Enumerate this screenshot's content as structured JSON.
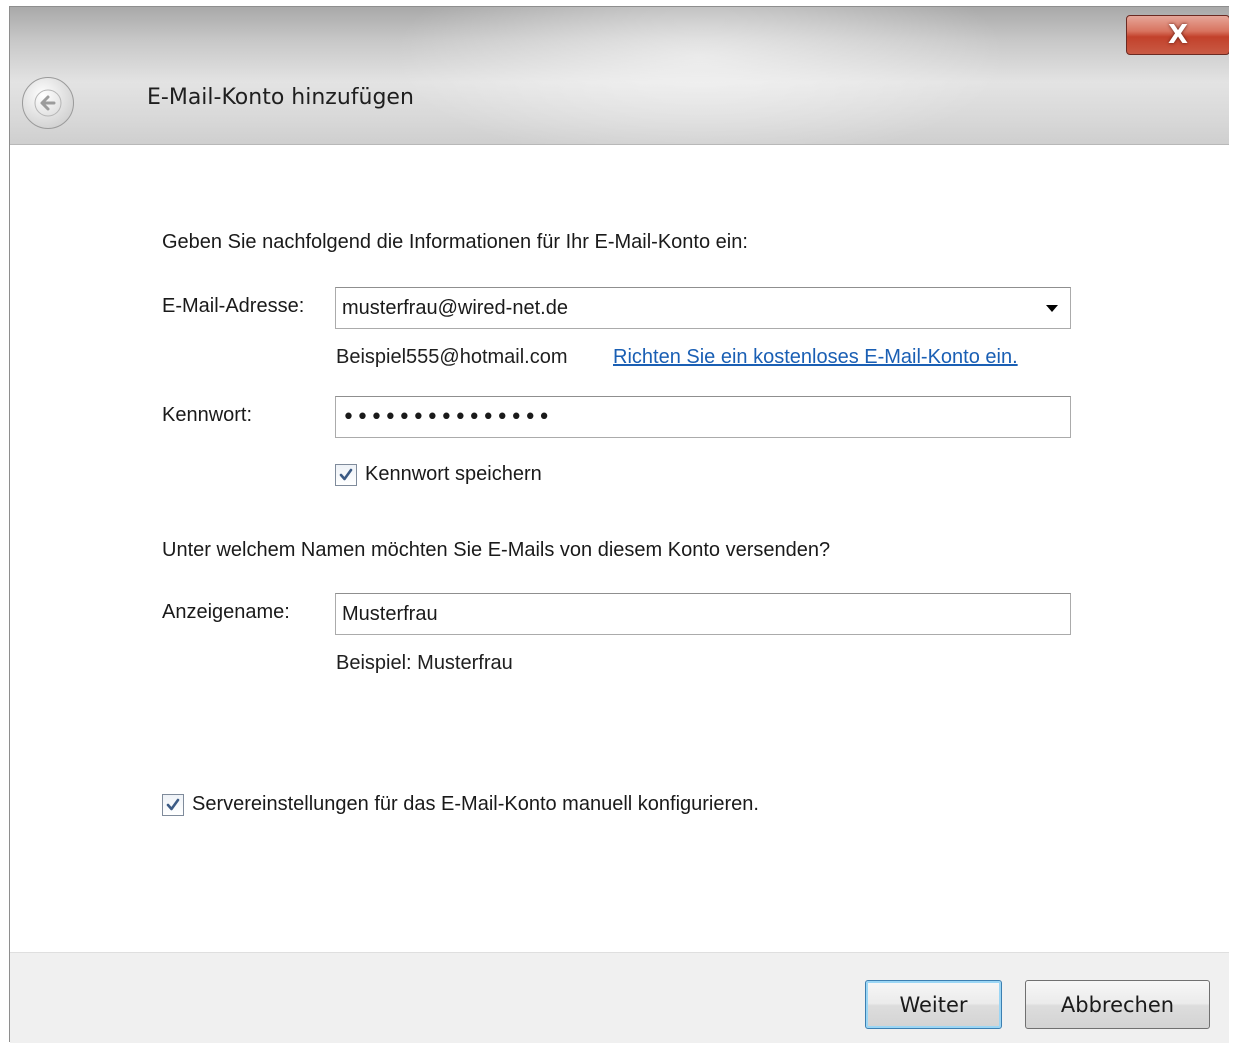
{
  "window": {
    "title": "E-Mail-Konto hinzufügen",
    "close_label": "X"
  },
  "form": {
    "intro": "Geben Sie nachfolgend die Informationen für Ihr E-Mail-Konto ein:",
    "email_label": "E-Mail-Adresse:",
    "email_value": "musterfrau@wired-net.de",
    "email_example": "Beispiel555@hotmail.com",
    "free_account_link": "Richten Sie ein kostenloses E-Mail-Konto ein.",
    "password_label": "Kennwort:",
    "password_value": "•••••••••••••••",
    "save_password_label": "Kennwort speichern",
    "save_password_checked": true,
    "name_question": "Unter welchem Namen möchten Sie E-Mails von diesem Konto versenden?",
    "display_name_label": "Anzeigename:",
    "display_name_value": "Musterfrau",
    "display_name_example": "Beispiel: Musterfrau",
    "manual_config_label": "Servereinstellungen für das E-Mail-Konto manuell konfigurieren.",
    "manual_config_checked": true
  },
  "buttons": {
    "next": "Weiter",
    "cancel": "Abbrechen"
  },
  "icons": {
    "back": "back-arrow-icon",
    "dropdown": "chevron-down-icon",
    "check": "checkmark-icon"
  },
  "colors": {
    "link": "#1a5fb4",
    "close_button": "#c2412b"
  }
}
